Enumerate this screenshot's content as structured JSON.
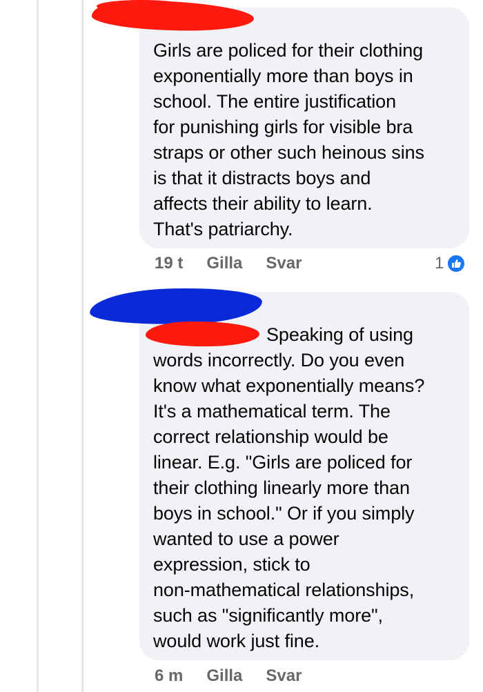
{
  "comments": [
    {
      "text": "Girls are policed for their clothing\nexponentially more than boys in\nschool. The entire justification\nfor punishing girls for visible bra\nstraps or other such heinous sins\nis that it distracts boys and\naffects their ability to learn.\nThat's patriarchy.",
      "time": "19 t",
      "like_label": "Gilla",
      "reply_label": "Svar",
      "reaction_count": "1",
      "reaction_icon": "like-icon"
    },
    {
      "text_first_line": "Speaking of using",
      "text_rest": "\nwords incorrectly. Do you even\nknow what exponentially means?\nIt's a mathematical term. The\ncorrect relationship would be\nlinear. E.g. \"Girls are policed for\ntheir clothing linearly more than\nboys in school.\" Or if you simply\nwanted to use a power\nexpression, stick to\nnon-mathematical relationships,\nsuch as \"significantly more\",\nwould work just fine.",
      "time": "6 m",
      "like_label": "Gilla",
      "reply_label": "Svar"
    }
  ],
  "colors": {
    "bubble_bg": "#f0f2f5",
    "meta_text": "#65676b",
    "like_blue": "#1877f2",
    "redaction_red": "#ff1a0f",
    "redaction_blue": "#0a2ad8"
  }
}
